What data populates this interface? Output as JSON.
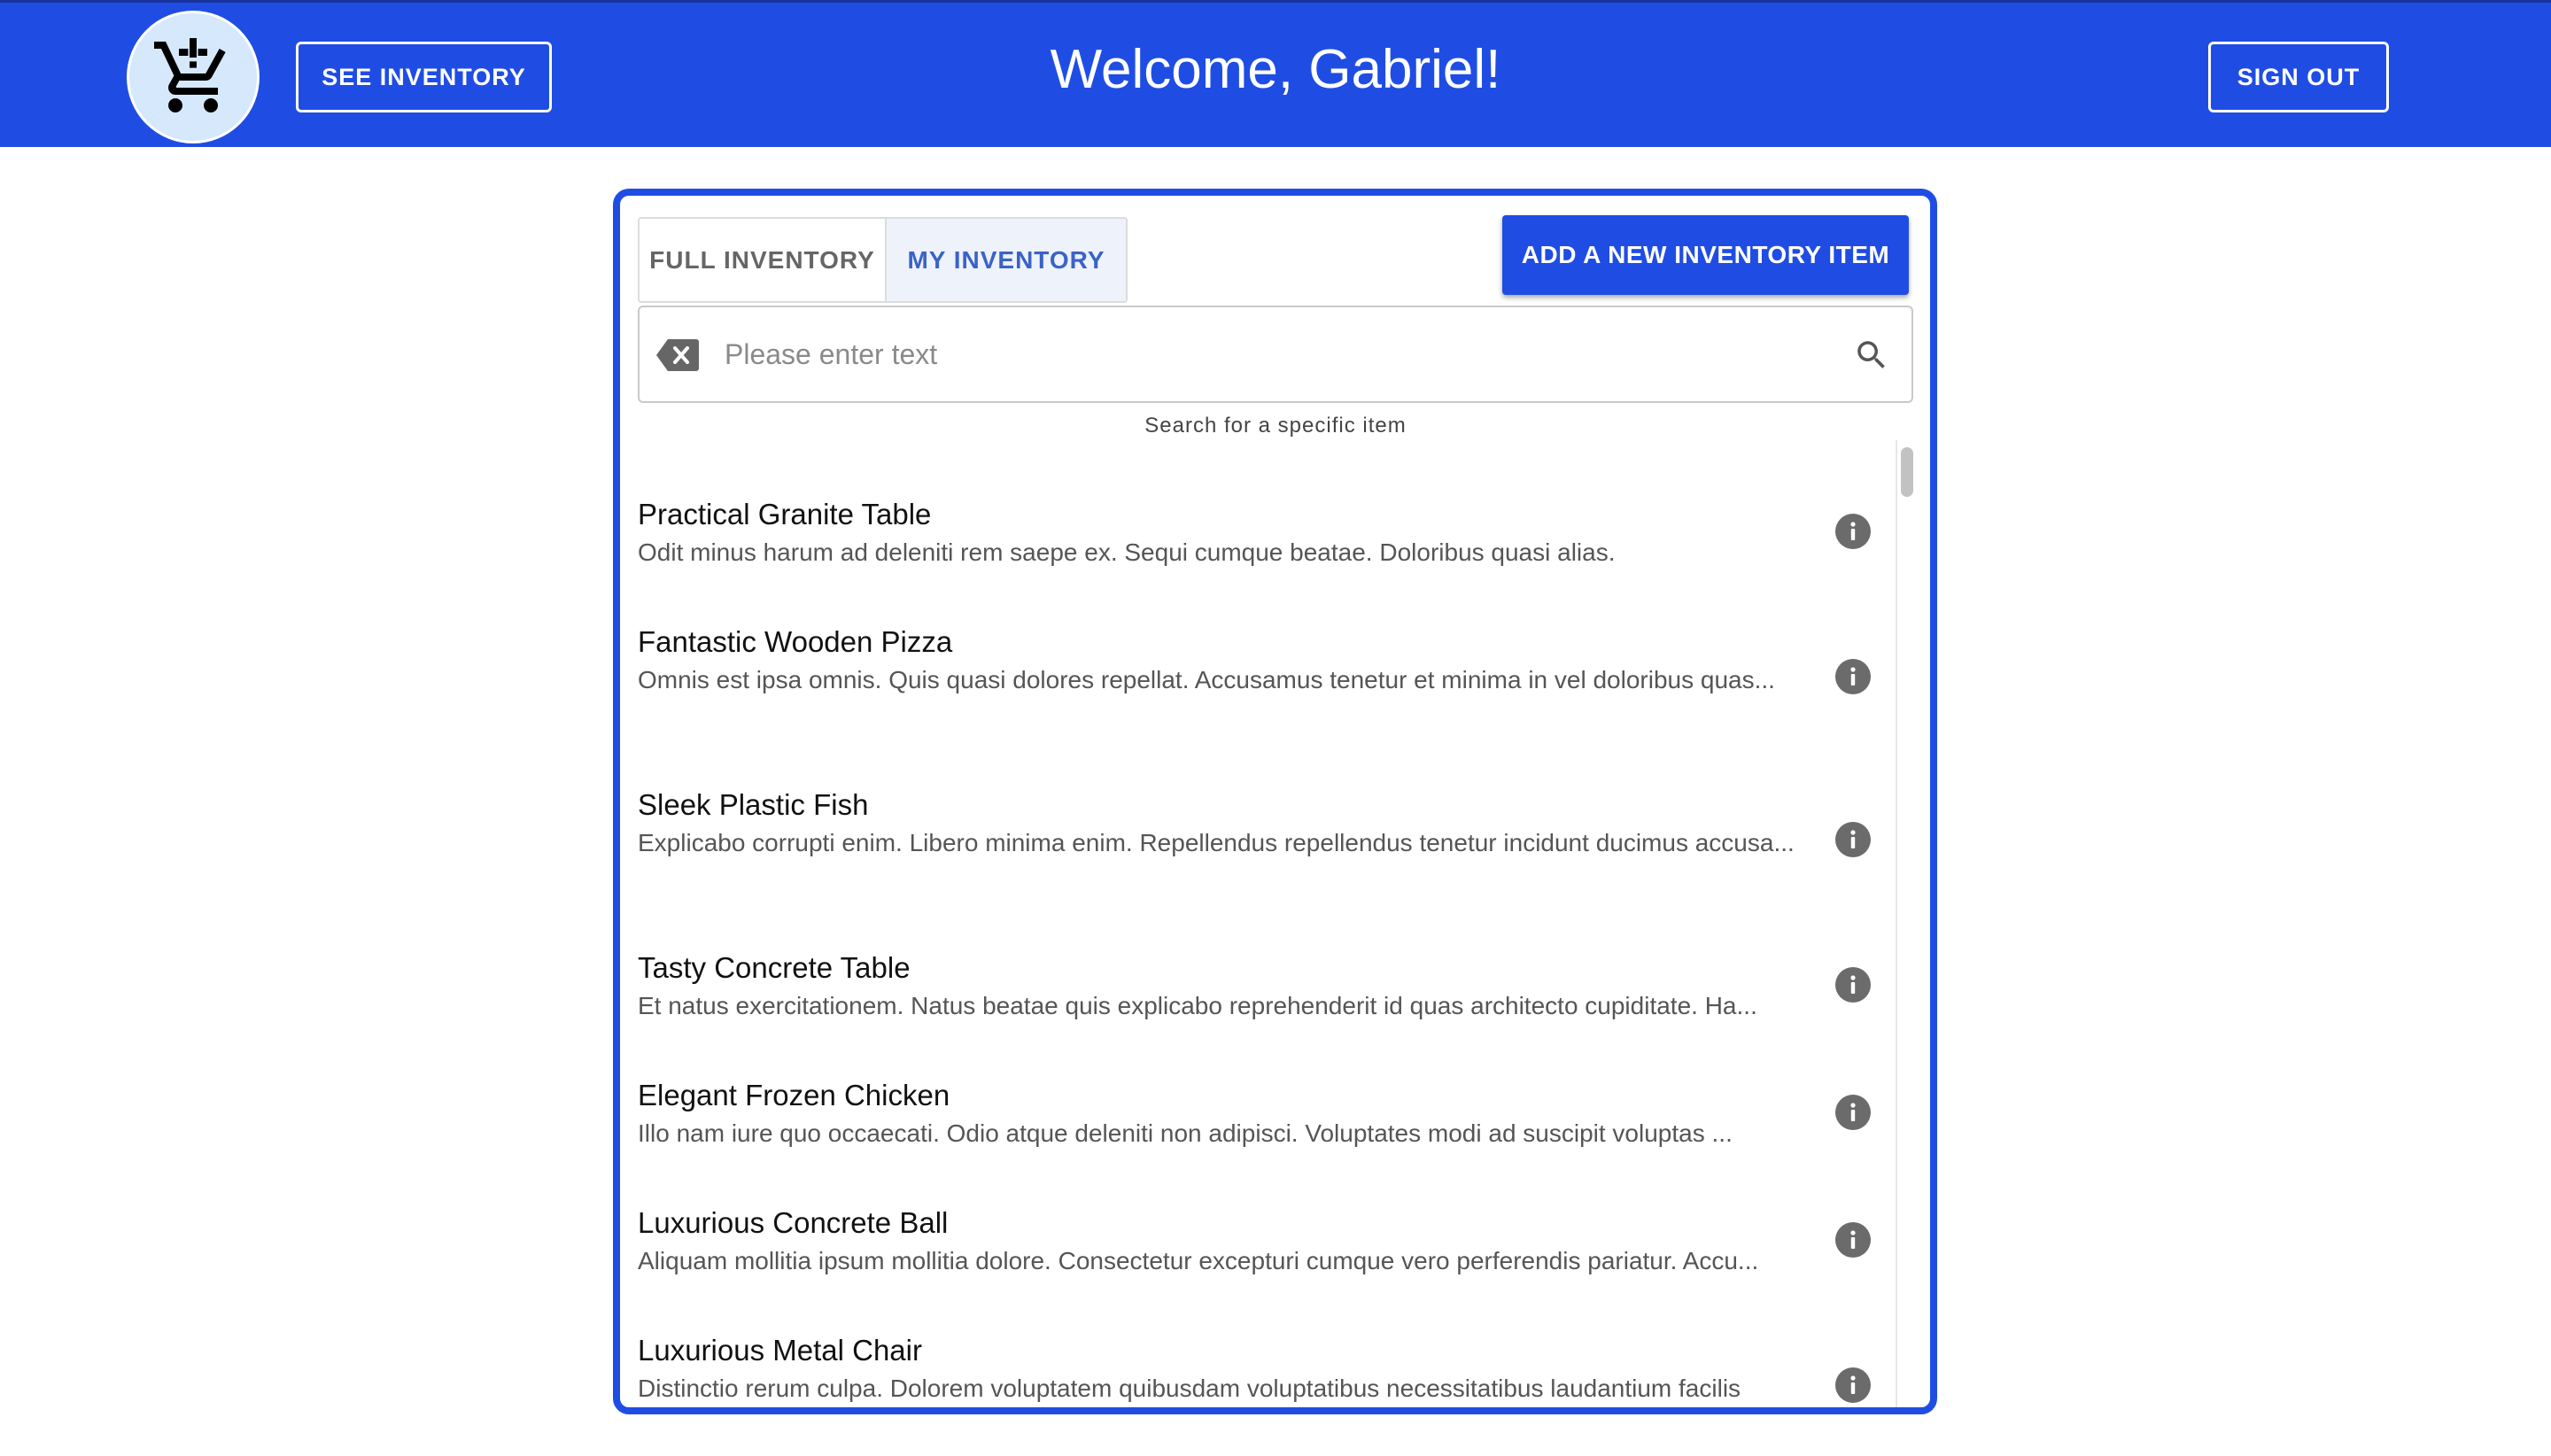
{
  "header": {
    "logo_icon": "shopping-cart-alert-icon",
    "see_inventory_label": "SEE INVENTORY",
    "welcome": "Welcome, Gabriel!",
    "sign_out_label": "SIGN OUT",
    "background_color": "#1f4de4"
  },
  "tabs": [
    {
      "label": "FULL INVENTORY",
      "active": false
    },
    {
      "label": "MY INVENTORY",
      "active": true
    }
  ],
  "add_button_label": "ADD A NEW INVENTORY ITEM",
  "search": {
    "placeholder": "Please enter text",
    "value": "",
    "helper": "Search for a specific item",
    "clear_icon": "backspace-icon",
    "search_icon": "search-icon"
  },
  "items": [
    {
      "title": "Practical Granite Table",
      "description": "Odit minus harum ad deleniti rem saepe ex. Sequi cumque beatae. Doloribus quasi alias."
    },
    {
      "title": "Fantastic Wooden Pizza",
      "description": "Omnis est ipsa omnis. Quis quasi dolores repellat. Accusamus tenetur et minima in vel doloribus quas..."
    },
    {
      "title": "Sleek Plastic Fish",
      "description": "Explicabo corrupti enim. Libero minima enim. Repellendus repellendus tenetur incidunt ducimus accusa..."
    },
    {
      "title": "Tasty Concrete Table",
      "description": "Et natus exercitationem. Natus beatae quis explicabo reprehenderit id quas architecto cupiditate. Ha..."
    },
    {
      "title": "Elegant Frozen Chicken",
      "description": "Illo nam iure quo occaecati. Odio atque deleniti non adipisci. Voluptates modi ad suscipit voluptas ..."
    },
    {
      "title": "Luxurious Concrete Ball",
      "description": "Aliquam mollitia ipsum mollitia dolore. Consectetur excepturi cumque vero perferendis pariatur. Accu..."
    },
    {
      "title": "Luxurious Metal Chair",
      "description": "Distinctio rerum culpa. Dolorem voluptatem quibusdam voluptatibus necessitatibus laudantium facilis"
    }
  ],
  "colors": {
    "accent": "#1f4de4",
    "active_tab_text": "#3a63c8",
    "info_icon": "#6b6b6b"
  }
}
